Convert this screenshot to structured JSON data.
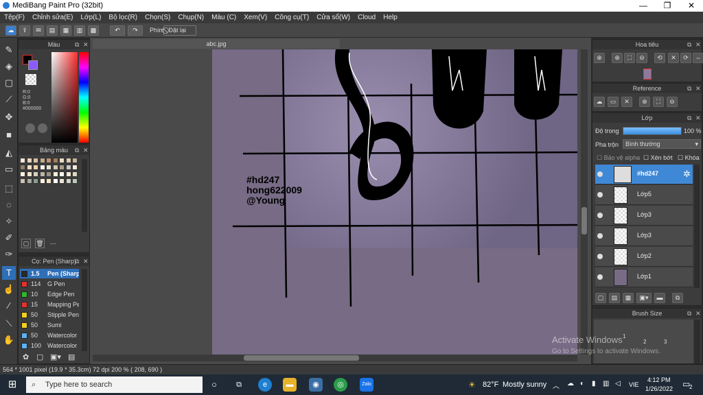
{
  "window": {
    "title": "MediBang Paint Pro (32bit)"
  },
  "menu": [
    "Tệp(F)",
    "Chỉnh sửa(E)",
    "Lớp(L)",
    "Bộ lọc(R)",
    "Chọn(S)",
    "Chụp(N)",
    "Màu (C)",
    "Xem(V)",
    "Công cụ(T)",
    "Cửa sổ(W)",
    "Cloud",
    "Help"
  ],
  "toolbar": {
    "mode_label": "Phím",
    "reset_label": "Đặt lại"
  },
  "color_panel": {
    "title": "Màu",
    "r": "R:0",
    "g": "G:0",
    "b": "B:0",
    "hex": "#000000"
  },
  "palette_panel": {
    "title": "Bảng màu",
    "footer": "---"
  },
  "brush_panel": {
    "title": "Cọ: Pen (Sharp)",
    "items": [
      {
        "size": "1.5",
        "name": "Pen (Sharp)",
        "color": "#2a2a2a"
      },
      {
        "size": "114",
        "name": "G Pen",
        "color": "#e63030"
      },
      {
        "size": "10",
        "name": "Edge Pen",
        "color": "#2fb82f"
      },
      {
        "size": "15",
        "name": "Mapping Pen",
        "color": "#e63030"
      },
      {
        "size": "50",
        "name": "Stipple Pen",
        "color": "#f0d020"
      },
      {
        "size": "50",
        "name": "Sumi",
        "color": "#f0d020"
      },
      {
        "size": "50",
        "name": "Watercolor",
        "color": "#5fb0f0"
      },
      {
        "size": "100",
        "name": "Watercolor",
        "color": "#5fb0f0"
      }
    ]
  },
  "document": {
    "tab": "abc.jpg",
    "overlay_text": [
      "#hd247",
      "hong622009",
      "@Young"
    ]
  },
  "nav_panel": {
    "title": "Hoa tiêu"
  },
  "reference_panel": {
    "title": "Reference"
  },
  "layer_panel": {
    "title": "Lớp",
    "opacity_label": "Độ trong",
    "opacity_value": "100 %",
    "opacity": 100,
    "blend_label": "Pha trộn",
    "blend_value": "Bình thường",
    "alpha_protect": "Bảo vệ alpha",
    "clipping": "Xén bớt",
    "lock": "Khóa",
    "layers": [
      {
        "name": "#hd247",
        "selected": true
      },
      {
        "name": "Lớp5",
        "selected": false
      },
      {
        "name": "Lớp3",
        "selected": false
      },
      {
        "name": "Lớp3",
        "selected": false
      },
      {
        "name": "Lớp2",
        "selected": false
      },
      {
        "name": "Lớp1",
        "selected": false
      }
    ]
  },
  "brush_size_panel": {
    "title": "Brush Size",
    "sizes": [
      "1",
      "2",
      "3"
    ]
  },
  "status": {
    "text": "564 * 1001 pixel   (19.9 * 35.3cm)   72 dpi   200 %   ( 208, 690 )"
  },
  "activation": {
    "line1": "Activate Windows",
    "line2": "Go to Settings to activate Windows."
  },
  "taskbar": {
    "search_placeholder": "Type here to search",
    "weather_temp": "82°F",
    "weather_desc": "Mostly sunny",
    "lang": "VIE",
    "time": "4:12 PM",
    "date": "1/26/2022",
    "notifications": "2"
  }
}
